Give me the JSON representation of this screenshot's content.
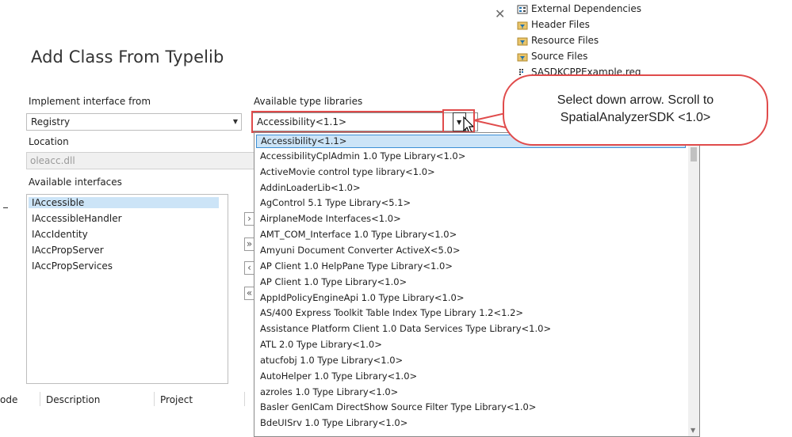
{
  "dialog": {
    "title": "Add Class From Typelib",
    "close_icon": "close-icon"
  },
  "form": {
    "implement_label": "Implement interface from",
    "implement_value": "Registry",
    "location_label": "Location",
    "location_value": "oleacc.dll",
    "available_interfaces_label": "Available interfaces",
    "interfaces": [
      "IAccessible",
      "IAccessibleHandler",
      "IAccIdentity",
      "IAccPropServer",
      "IAccPropServices"
    ],
    "available_typelibs_label": "Available type libraries",
    "typelib_value": "Accessibility<1.1>"
  },
  "move_buttons": [
    "›",
    "»",
    "‹",
    "«"
  ],
  "typelibs": [
    "Accessibility<1.1>",
    "AccessibilityCplAdmin 1.0 Type Library<1.0>",
    "ActiveMovie control type library<1.0>",
    "AddinLoaderLib<1.0>",
    "AgControl 5.1 Type Library<5.1>",
    "AirplaneMode Interfaces<1.0>",
    "AMT_COM_Interface 1.0 Type Library<1.0>",
    "Amyuni Document Converter ActiveX<5.0>",
    "AP Client 1.0 HelpPane Type Library<1.0>",
    "AP Client 1.0 Type Library<1.0>",
    "AppIdPolicyEngineApi 1.0 Type Library<1.0>",
    "AS/400 Express Toolkit Table Index Type Library 1.2<1.2>",
    "Assistance Platform Client 1.0 Data Services Type Library<1.0>",
    "ATL 2.0 Type Library<1.0>",
    "atucfobj 1.0 Type Library<1.0>",
    "AutoHelper 1.0 Type Library<1.0>",
    "azroles 1.0 Type Library<1.0>",
    "Basler GenICam DirectShow Source Filter Type Library<1.0>",
    "BdeUISrv 1.0 Type Library<1.0>"
  ],
  "solution_tree": [
    {
      "label": "External Dependencies",
      "icon": "dependencies-icon"
    },
    {
      "label": "Header Files",
      "icon": "filter-folder-icon"
    },
    {
      "label": "Resource Files",
      "icon": "filter-folder-icon"
    },
    {
      "label": "Source Files",
      "icon": "filter-folder-icon"
    },
    {
      "label": "SASDKCPPExample.reg",
      "icon": "reg-file-icon"
    }
  ],
  "callout": {
    "line1": "Select down arrow. Scroll to",
    "line2": "SpatialAnalyzerSDK <1.0>"
  },
  "error_list": {
    "col_code": "ode",
    "col_description": "Description",
    "col_project": "Project"
  },
  "colors": {
    "selection": "#cce4f7",
    "selection_border": "#3c8fd6",
    "annotation_red": "#e04b4b"
  }
}
